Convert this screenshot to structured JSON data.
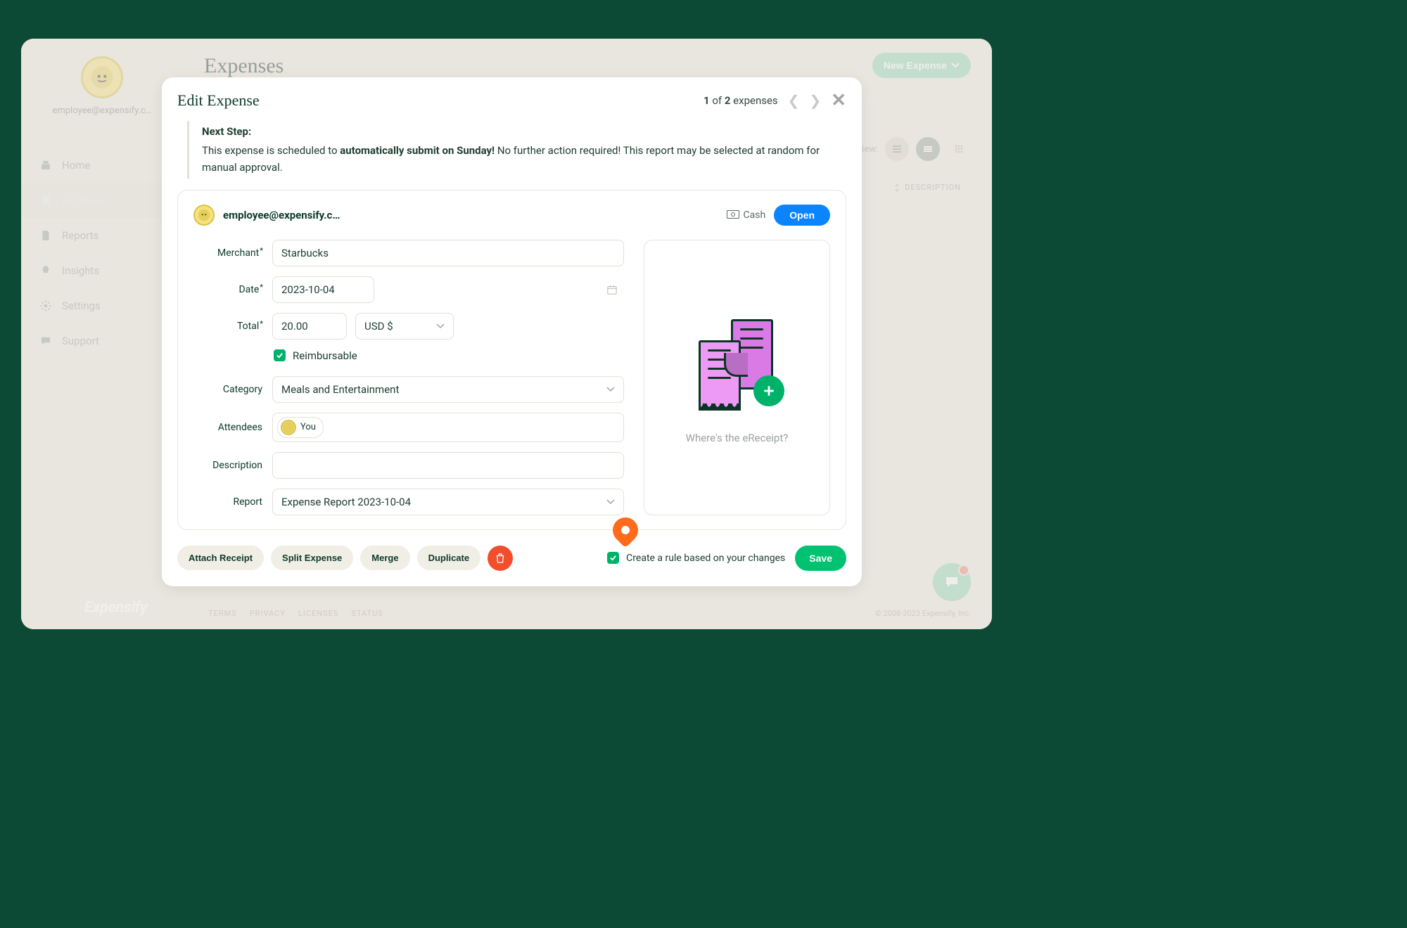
{
  "brand": "Expensify",
  "profile": {
    "email": "employee@expensify.c…"
  },
  "sidebar": {
    "items": [
      {
        "label": "Home"
      },
      {
        "label": "Expenses"
      },
      {
        "label": "Reports"
      },
      {
        "label": "Insights"
      },
      {
        "label": "Settings"
      },
      {
        "label": "Support"
      }
    ]
  },
  "page": {
    "title": "Expenses",
    "new_expense": "New Expense",
    "view_label": "View:",
    "col_description": "DESCRIPTION"
  },
  "footer": {
    "terms": "TERMS",
    "privacy": "PRIVACY",
    "licenses": "LICENSES",
    "status": "STATUS",
    "copyright": "© 2008-2023 Expensify, Inc."
  },
  "modal": {
    "title": "Edit Expense",
    "pager_current": "1",
    "pager_total": "2",
    "pager_of": "of",
    "pager_suffix": "expenses",
    "next_step_hdr": "Next Step:",
    "next_step_pre": "This expense is scheduled to ",
    "next_step_bold": "automatically submit on Sunday!",
    "next_step_post": " No further action required! This report may be selected at random for manual approval.",
    "user_email": "employee@expensify.c…",
    "cash_label": "Cash",
    "open_label": "Open",
    "labels": {
      "merchant": "Merchant",
      "date": "Date",
      "total": "Total",
      "reimbursable": "Reimbursable",
      "category": "Category",
      "attendees": "Attendees",
      "description": "Description",
      "report": "Report"
    },
    "values": {
      "merchant": "Starbucks",
      "date": "2023-10-04",
      "total": "20.00",
      "currency": "USD $",
      "reimbursable": true,
      "category": "Meals and Entertainment",
      "attendee": "You",
      "description": "",
      "report": "Expense Report 2023-10-04"
    },
    "receipt_q": "Where's the eReceipt?",
    "buttons": {
      "attach": "Attach Receipt",
      "split": "Split Expense",
      "merge": "Merge",
      "duplicate": "Duplicate",
      "rule": "Create a rule based on your changes",
      "save": "Save"
    }
  }
}
